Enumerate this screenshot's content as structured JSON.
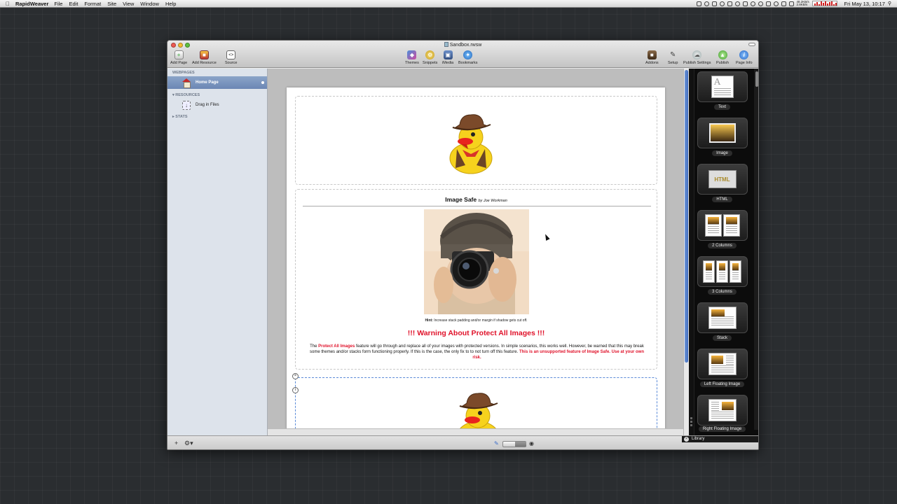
{
  "menubar": {
    "app_name": "RapidWeaver",
    "menus": [
      "File",
      "Edit",
      "Format",
      "Site",
      "View",
      "Window",
      "Help"
    ],
    "net_up": "48.2KB/s",
    "net_down": "2.8KB/s",
    "clock": "Fri May 13, 10:17"
  },
  "window": {
    "title": "Sandbox.rwsw",
    "toolbar": {
      "add_page": "Add Page",
      "add_resource": "Add Resource",
      "source": "Source",
      "themes": "Themes",
      "snippets": "Snippets",
      "imedia": "iMedia",
      "bookmarks": "Bookmarks",
      "addons": "Addons",
      "setup": "Setup",
      "publish_settings": "Publish Settings",
      "publish": "Publish",
      "page_info": "Page Info"
    }
  },
  "sidebar": {
    "webpages_header": "WEBPAGES",
    "home_page": "Home Page",
    "resources_header": "RESOURCES",
    "drag_in_files": "Drag in Files",
    "stats_header": "STATS"
  },
  "content": {
    "image_safe_title": "Image Safe",
    "image_safe_author": "by Joe Workman",
    "hint_label": "Hint:",
    "hint_text": "Increase stack padding and/or margin if shadow gets cut off.",
    "warning_title": "!!! Warning About Protect All Images !!!",
    "warning_prefix": "The",
    "warning_link": "Protect All Images",
    "warning_body": "feature will go through and replace all of your images with protected versions. In simple scenarios, this works well. However, be warned that this may break some themes and/or stacks form functioning properly. If this is the case, the only fix to to not turn off this feature.",
    "warning_red": "This is an unsupported feature of Image Safe. Use at your own risk."
  },
  "library": {
    "items": [
      "Text",
      "Image",
      "HTML",
      "2 Columns",
      "3 Columns",
      "Stack",
      "Left Floating Image",
      "Right Floating Image"
    ],
    "footer": "Library"
  },
  "colors": {
    "accent_red": "#e0122a",
    "selection_blue": "#6b87b4",
    "scroll_blue": "#3e6bc0"
  }
}
